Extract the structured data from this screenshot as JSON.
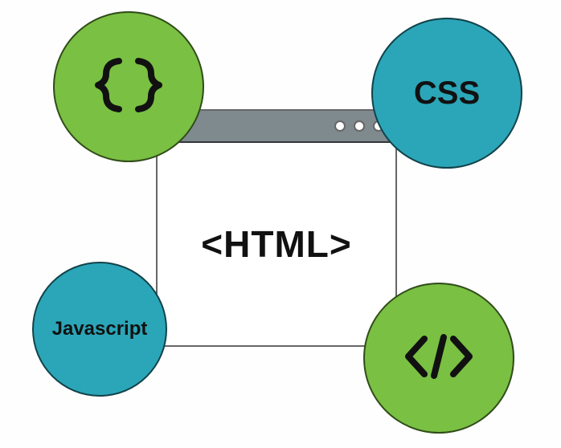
{
  "diagram": {
    "center": {
      "label": "<HTML>"
    },
    "corners": {
      "top_left": {
        "icon": "curly-braces"
      },
      "top_right": {
        "label": "CSS"
      },
      "bottom_left": {
        "label": "Javascript"
      },
      "bottom_right": {
        "icon": "closing-tag"
      }
    },
    "colors": {
      "green": "#7ac043",
      "teal": "#2ba6b8",
      "titlebar": "#7f8a8f"
    }
  }
}
